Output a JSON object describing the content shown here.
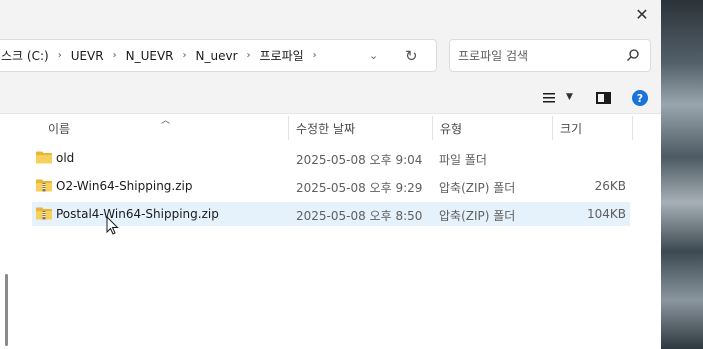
{
  "window": {
    "close_glyph": "✕"
  },
  "address": {
    "crumbs": [
      "스크 (C:)",
      "UEVR",
      "N_UEVR",
      "N_uevr",
      "프로파일"
    ],
    "separator": "›",
    "dropdown_glyph": "⌄",
    "refresh_glyph": "↻"
  },
  "search": {
    "placeholder": "프로파일 검색"
  },
  "toolbar": {
    "view_icon": "list-view-icon",
    "details_pane_icon": "details-pane-icon",
    "help_label": "?"
  },
  "columns": {
    "name": "이름",
    "date": "수정한 날짜",
    "type": "유형",
    "size": "크기"
  },
  "files": [
    {
      "name": "old",
      "date": "2025-05-08 오후 9:04",
      "type": "파일 폴더",
      "size": "",
      "icon": "folder-icon"
    },
    {
      "name": "O2-Win64-Shipping.zip",
      "date": "2025-05-08 오후 9:29",
      "type": "압축(ZIP) 폴더",
      "size": "26KB",
      "icon": "zip-folder-icon"
    },
    {
      "name": "Postal4-Win64-Shipping.zip",
      "date": "2025-05-08 오후 8:50",
      "type": "압축(ZIP) 폴더",
      "size": "104KB",
      "icon": "zip-folder-icon",
      "selected": true
    }
  ],
  "colors": {
    "accent": "#1a73d9",
    "selection": "#e5f1fb",
    "folder": "#f0c14b"
  }
}
